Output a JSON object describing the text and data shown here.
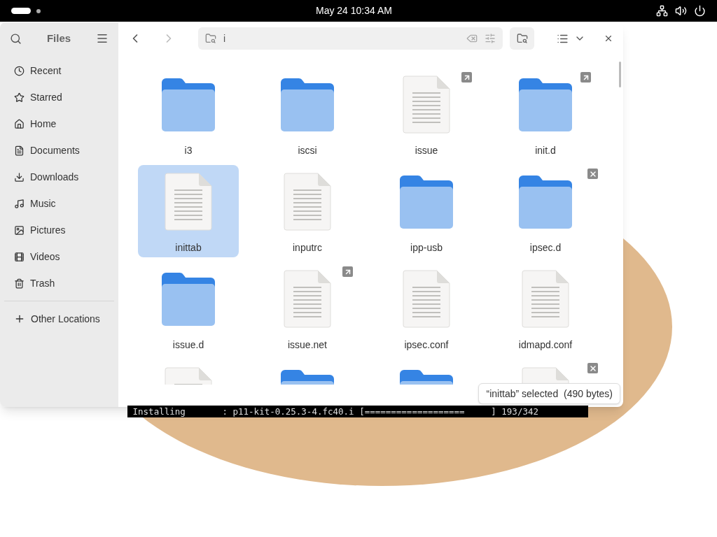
{
  "top_bar": {
    "clock": "May 24  10:34 AM"
  },
  "sidebar": {
    "title": "Files",
    "items": [
      {
        "label": "Recent",
        "selected": false
      },
      {
        "label": "Starred",
        "selected": false
      },
      {
        "label": "Home",
        "selected": false
      },
      {
        "label": "Documents",
        "selected": false
      },
      {
        "label": "Downloads",
        "selected": false
      },
      {
        "label": "Music",
        "selected": false
      },
      {
        "label": "Pictures",
        "selected": false
      },
      {
        "label": "Videos",
        "selected": false
      },
      {
        "label": "Trash",
        "selected": false
      }
    ],
    "other": {
      "label": "Other Locations"
    }
  },
  "search": {
    "value": "i"
  },
  "files": [
    {
      "name": "i3",
      "kind": "folder",
      "link": false,
      "no_access": false,
      "selected": false
    },
    {
      "name": "iscsi",
      "kind": "folder",
      "link": false,
      "no_access": false,
      "selected": false
    },
    {
      "name": "issue",
      "kind": "file",
      "link": true,
      "no_access": false,
      "selected": false
    },
    {
      "name": "init.d",
      "kind": "folder",
      "link": true,
      "no_access": false,
      "selected": false
    },
    {
      "name": "inittab",
      "kind": "file",
      "link": false,
      "no_access": false,
      "selected": true
    },
    {
      "name": "inputrc",
      "kind": "file",
      "link": false,
      "no_access": false,
      "selected": false
    },
    {
      "name": "ipp-usb",
      "kind": "folder",
      "link": false,
      "no_access": false,
      "selected": false
    },
    {
      "name": "ipsec.d",
      "kind": "folder",
      "link": false,
      "no_access": true,
      "selected": false
    },
    {
      "name": "issue.d",
      "kind": "folder",
      "link": false,
      "no_access": false,
      "selected": false
    },
    {
      "name": "issue.net",
      "kind": "file",
      "link": true,
      "no_access": false,
      "selected": false
    },
    {
      "name": "ipsec.conf",
      "kind": "file",
      "link": false,
      "no_access": false,
      "selected": false
    },
    {
      "name": "idmapd.conf",
      "kind": "file",
      "link": false,
      "no_access": false,
      "selected": false
    },
    {
      "kind": "file",
      "link": false,
      "no_access": false,
      "selected": false
    },
    {
      "kind": "folder",
      "link": false,
      "no_access": false,
      "selected": false
    },
    {
      "kind": "folder",
      "link": false,
      "no_access": false,
      "selected": false
    },
    {
      "kind": "file",
      "link": false,
      "no_access": true,
      "selected": false
    }
  ],
  "status_popup": "“inittab” selected  (490 bytes)",
  "terminal": {
    "line": " Installing       : p11-kit-0.25.3-4.fc40.i [===================     ] 193/342"
  }
}
